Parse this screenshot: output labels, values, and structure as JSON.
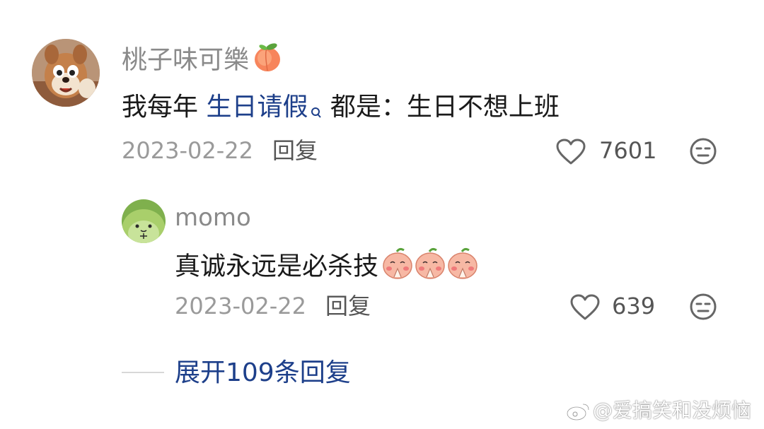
{
  "comment": {
    "username": "桃子味可樂",
    "text_before": "我每年 ",
    "link_text": "生日请假",
    "text_after": " 都是：生日不想上班",
    "date": "2023-02-22",
    "reply_label": "回复",
    "like_count": "7601"
  },
  "reply": {
    "username": "momo",
    "text": "真诚永远是必杀技",
    "date": "2023-02-22",
    "reply_label": "回复",
    "like_count": "639"
  },
  "expand_label": "展开109条回复",
  "watermark": "@爱搞笑和没烦恼",
  "colors": {
    "link": "#1d3f8a",
    "meta": "#9a9a9a",
    "username": "#8a8a8a"
  }
}
